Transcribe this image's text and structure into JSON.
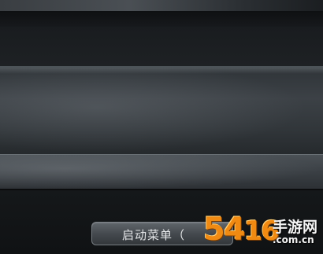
{
  "menu": {
    "start_menu_label": "启动菜单（"
  },
  "watermark": {
    "number_text": "54",
    "logo_glyph": "16",
    "site_name": "手游网",
    "domain": ".com.cn"
  },
  "colors": {
    "watermark_accent": "#f08a12",
    "button_text": "#e4e6e8"
  }
}
